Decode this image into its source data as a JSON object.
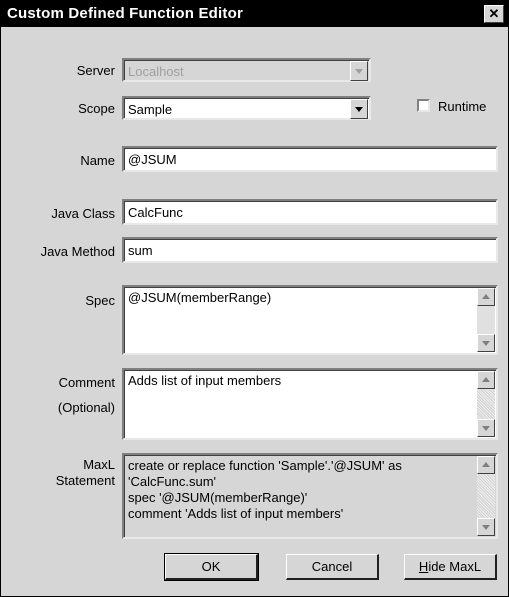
{
  "window": {
    "title": "Custom Defined Function Editor",
    "close_glyph": "✕"
  },
  "form": {
    "server": {
      "label": "Server",
      "value": "Localhost"
    },
    "scope": {
      "label": "Scope",
      "value": "Sample"
    },
    "runtime": {
      "label": "Runtime",
      "checked": false
    },
    "name": {
      "label": "Name",
      "value": "@JSUM"
    },
    "java_class": {
      "label": "Java Class",
      "value": "CalcFunc"
    },
    "java_method": {
      "label": "Java Method",
      "value": "sum"
    },
    "spec": {
      "label": "Spec",
      "value": "@JSUM(memberRange)"
    },
    "comment": {
      "label_line1": "Comment",
      "label_line2": "(Optional)",
      "value": "Adds list of input members"
    },
    "maxl": {
      "label_line1": "MaxL",
      "label_line2": "Statement",
      "lines": [
        "create or replace function 'Sample'.'@JSUM' as",
        "'CalcFunc.sum'",
        "spec '@JSUM(memberRange)'",
        "comment 'Adds list of input members'"
      ]
    }
  },
  "buttons": {
    "ok": "OK",
    "cancel": "Cancel",
    "hide_maxl_hotkey": "H",
    "hide_maxl_rest": "ide MaxL"
  }
}
